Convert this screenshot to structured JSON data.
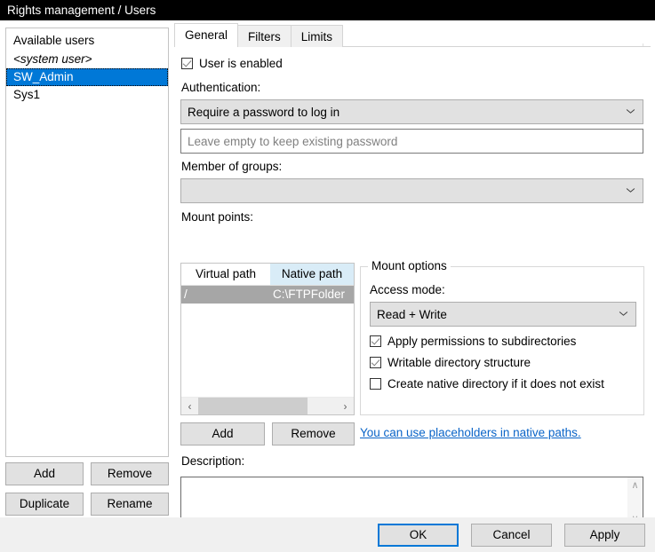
{
  "window": {
    "title": "Rights management / Users"
  },
  "sidebar": {
    "header": "Available users",
    "users": [
      {
        "label": "<system user>",
        "selected": false,
        "italic": true
      },
      {
        "label": "SW_Admin",
        "selected": true,
        "italic": false
      },
      {
        "label": "Sys1",
        "selected": false,
        "italic": false
      }
    ],
    "buttons": {
      "add": "Add",
      "remove": "Remove",
      "duplicate": "Duplicate",
      "rename": "Rename"
    }
  },
  "tabs": [
    {
      "label": "General",
      "active": true
    },
    {
      "label": "Filters",
      "active": false
    },
    {
      "label": "Limits",
      "active": false
    }
  ],
  "general": {
    "user_enabled": {
      "label": "User is enabled",
      "checked": true
    },
    "authentication": {
      "label": "Authentication:",
      "selected": "Require a password to log in"
    },
    "password": {
      "placeholder": "Leave empty to keep existing password",
      "value": ""
    },
    "groups": {
      "label": "Member of groups:",
      "selected": ""
    },
    "mount_points": {
      "label": "Mount points:",
      "columns": [
        "Virtual path",
        "Native path"
      ],
      "rows": [
        {
          "virtual_path": "/",
          "native_path": "C:\\FTPFolder",
          "selected": true
        }
      ],
      "scroll_left_icon": "‹",
      "scroll_right_icon": "›",
      "add_label": "Add",
      "remove_label": "Remove",
      "placeholder_link": "You can use placeholders in native paths."
    },
    "mount_options": {
      "legend": "Mount options",
      "access_mode_label": "Access mode:",
      "access_mode_value": "Read + Write",
      "options": [
        {
          "label": "Apply permissions to subdirectories",
          "checked": true
        },
        {
          "label": "Writable directory structure",
          "checked": true
        },
        {
          "label": "Create native directory if it does not exist",
          "checked": false
        }
      ]
    },
    "description": {
      "label": "Description:",
      "value": "",
      "scroll_up_icon": "∧",
      "scroll_down_icon": "∨"
    }
  },
  "footer": {
    "ok": "OK",
    "cancel": "Cancel",
    "apply": "Apply"
  },
  "colors": {
    "titlebar_bg": "#000000",
    "selection_blue": "#0078d7",
    "row_selection_gray": "#a6a6a6",
    "link_blue": "#0a64c8",
    "column_highlight": "#d9ecf7"
  }
}
